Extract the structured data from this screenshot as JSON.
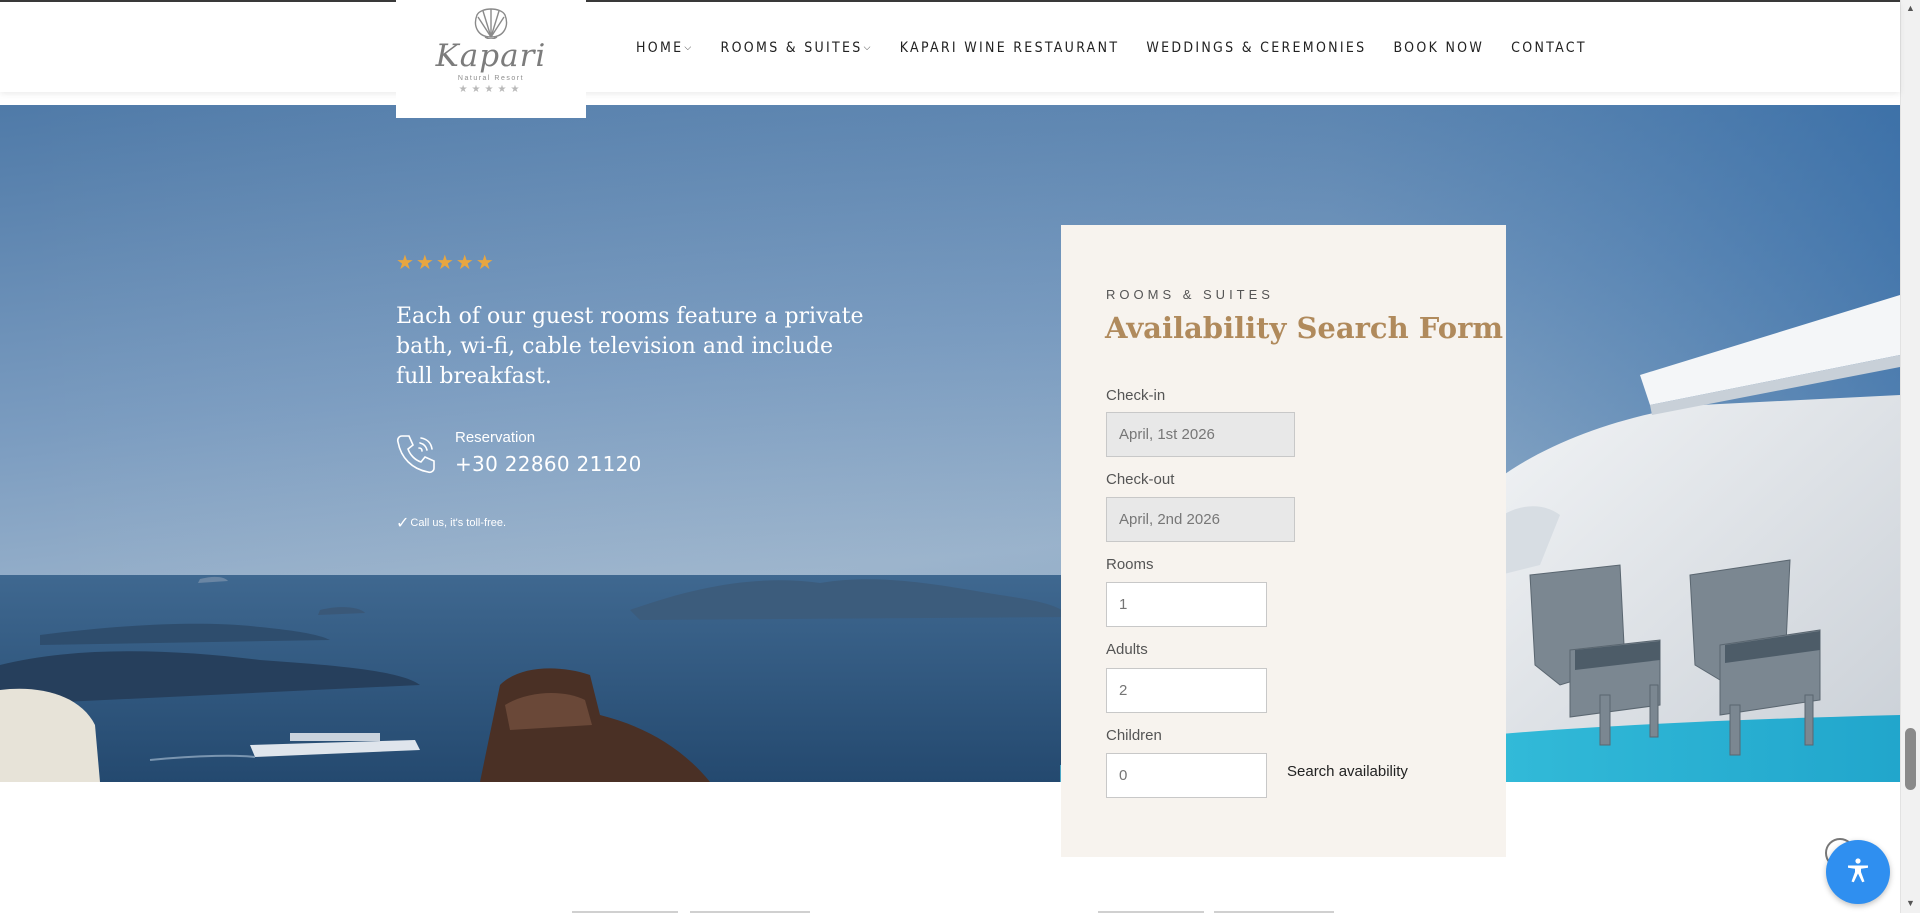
{
  "header": {
    "logo": {
      "name": "Kapari",
      "subtitle": "Natural Resort",
      "stars": "★★★★★"
    },
    "nav": [
      {
        "label": "HOME",
        "has_dropdown": true
      },
      {
        "label": "ROOMS & SUITES",
        "has_dropdown": true
      },
      {
        "label": "KAPARI WINE RESTAURANT",
        "has_dropdown": false
      },
      {
        "label": "WEDDINGS & CEREMONIES",
        "has_dropdown": false
      },
      {
        "label": "BOOK NOW",
        "has_dropdown": false
      },
      {
        "label": "CONTACT",
        "has_dropdown": false
      }
    ],
    "chevron": "⌵"
  },
  "hero": {
    "stars": "★★★★★",
    "tagline": "Each of our guest rooms feature a private bath, wi-fi, cable television and include full breakfast.",
    "reservation_label": "Reservation",
    "reservation_number": "+30 22860 21120",
    "tollfree_check": "✓",
    "tollfree_text": "Call us, it's toll-free."
  },
  "form": {
    "eyebrow": "ROOMS & SUITES",
    "title": "Availability Search Form",
    "checkin": {
      "label": "Check-in",
      "value": "April, 1st 2026"
    },
    "checkout": {
      "label": "Check-out",
      "value": "April, 2nd 2026"
    },
    "rooms": {
      "label": "Rooms",
      "placeholder": "1"
    },
    "adults": {
      "label": "Adults",
      "placeholder": "2"
    },
    "children": {
      "label": "Children",
      "placeholder": "0"
    },
    "submit_label": "Search availability"
  },
  "colors": {
    "accent_gold": "#b08a5c",
    "star_orange": "#e8a640",
    "form_bg": "#f7f3ee",
    "a11y_blue": "#2f8ff0"
  },
  "icons": [
    "shell-logo-icon",
    "phone-icon",
    "check-icon",
    "accessibility-icon",
    "chevron-down-icon"
  ],
  "scrollbar": {
    "up": "▲",
    "down": "▼"
  }
}
